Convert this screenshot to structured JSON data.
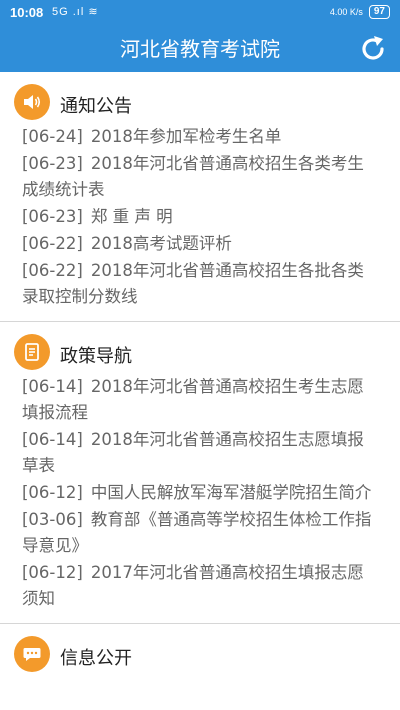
{
  "status": {
    "time": "10:08",
    "signal": "5G .ıl ≋",
    "net_speed": "4.00 K/s",
    "battery": "97"
  },
  "appbar": {
    "title": "河北省教育考试院",
    "refresh_icon": "refresh-icon"
  },
  "colors": {
    "primary": "#2f8ed9",
    "icon_orange": "#f39a2b"
  },
  "sections": [
    {
      "title": "通知公告",
      "icon": "speaker-icon",
      "items": [
        {
          "date": "[06-24]",
          "text": "2018年参加军检考生名单"
        },
        {
          "date": "[06-23]",
          "text": "2018年河北省普通高校招生各类考生成绩统计表"
        },
        {
          "date": "[06-23]",
          "text": "郑 重 声 明"
        },
        {
          "date": "[06-22]",
          "text": "2018高考试题评析"
        },
        {
          "date": "[06-22]",
          "text": "2018年河北省普通高校招生各批各类录取控制分数线"
        }
      ]
    },
    {
      "title": "政策导航",
      "icon": "document-icon",
      "items": [
        {
          "date": "[06-14]",
          "text": "2018年河北省普通高校招生考生志愿填报流程"
        },
        {
          "date": "[06-14]",
          "text": "2018年河北省普通高校招生志愿填报草表"
        },
        {
          "date": "[06-12]",
          "text": "中国人民解放军海军潜艇学院招生简介"
        },
        {
          "date": "[03-06]",
          "text": "教育部《普通高等学校招生体检工作指导意见》"
        },
        {
          "date": "[06-12]",
          "text": "2017年河北省普通高校招生填报志愿须知"
        }
      ]
    },
    {
      "title": "信息公开",
      "icon": "chat-icon",
      "items": []
    }
  ]
}
